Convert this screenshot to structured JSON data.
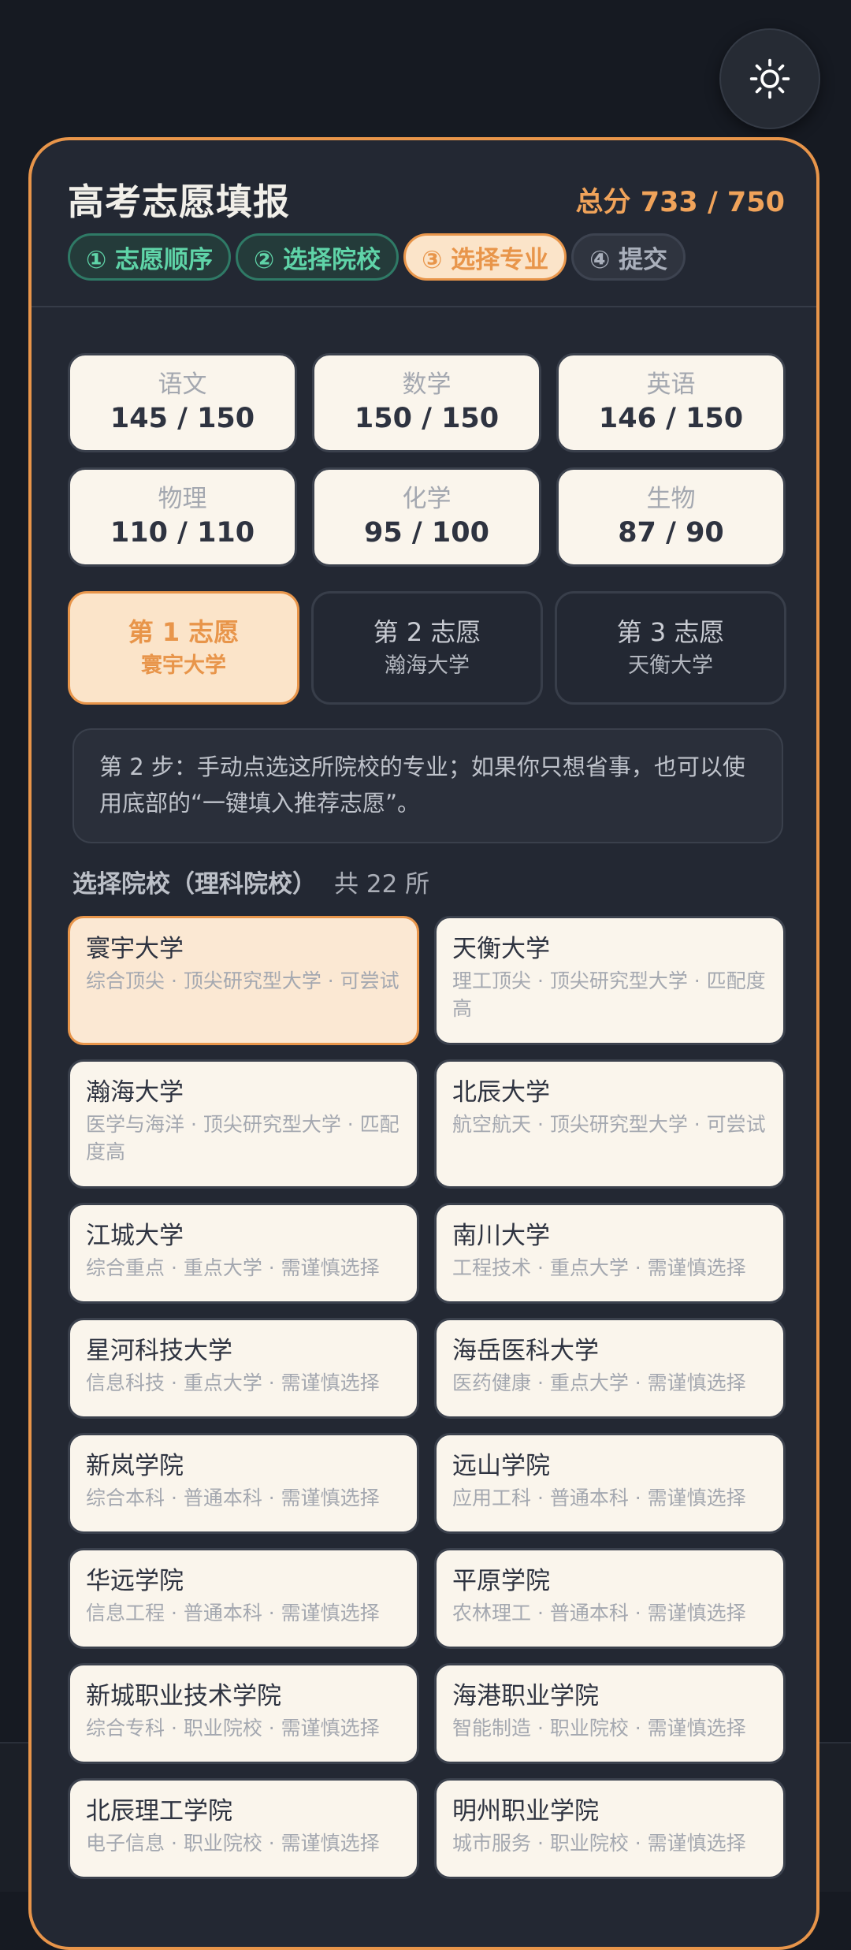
{
  "header": {
    "title": "高考志愿填报",
    "total_score": "总分 733 / 750"
  },
  "steps": [
    {
      "label": "① 志愿顺序",
      "state": "done"
    },
    {
      "label": "② 选择院校",
      "state": "done"
    },
    {
      "label": "③ 选择专业",
      "state": "active"
    },
    {
      "label": "④ 提交",
      "state": "todo"
    }
  ],
  "scores": [
    {
      "subject": "语文",
      "value": "145 / 150"
    },
    {
      "subject": "数学",
      "value": "150 / 150"
    },
    {
      "subject": "英语",
      "value": "146 / 150"
    },
    {
      "subject": "物理",
      "value": "110 / 110"
    },
    {
      "subject": "化学",
      "value": "95 / 100"
    },
    {
      "subject": "生物",
      "value": "87 / 90"
    }
  ],
  "choices": [
    {
      "title": "第 1 志愿",
      "school": "寰宇大学",
      "active": true
    },
    {
      "title": "第 2 志愿",
      "school": "瀚海大学",
      "active": false
    },
    {
      "title": "第 3 志愿",
      "school": "天衡大学",
      "active": false
    }
  ],
  "hint": "第 2 步：手动点选这所院校的专业；如果你只想省事，也可以使用底部的“一键填入推荐志愿”。",
  "schools_section": {
    "title": "选择院校（理科院校）",
    "count": "共 22 所"
  },
  "schools": [
    {
      "name": "寰宇大学",
      "meta": "综合顶尖 · 顶尖研究型大学 · 可尝试",
      "selected": true
    },
    {
      "name": "天衡大学",
      "meta": "理工顶尖 · 顶尖研究型大学 · 匹配度高"
    },
    {
      "name": "瀚海大学",
      "meta": "医学与海洋 · 顶尖研究型大学 · 匹配度高"
    },
    {
      "name": "北辰大学",
      "meta": "航空航天 · 顶尖研究型大学 · 可尝试"
    },
    {
      "name": "江城大学",
      "meta": "综合重点 · 重点大学 · 需谨慎选择"
    },
    {
      "name": "南川大学",
      "meta": "工程技术 · 重点大学 · 需谨慎选择"
    },
    {
      "name": "星河科技大学",
      "meta": "信息科技 · 重点大学 · 需谨慎选择"
    },
    {
      "name": "海岳医科大学",
      "meta": "医药健康 · 重点大学 · 需谨慎选择"
    },
    {
      "name": "新岚学院",
      "meta": "综合本科 · 普通本科 · 需谨慎选择"
    },
    {
      "name": "远山学院",
      "meta": "应用工科 · 普通本科 · 需谨慎选择"
    },
    {
      "name": "华远学院",
      "meta": "信息工程 · 普通本科 · 需谨慎选择"
    },
    {
      "name": "平原学院",
      "meta": "农林理工 · 普通本科 · 需谨慎选择"
    },
    {
      "name": "新城职业技术学院",
      "meta": "综合专科 · 职业院校 · 需谨慎选择"
    },
    {
      "name": "海港职业学院",
      "meta": "智能制造 · 职业院校 · 需谨慎选择"
    },
    {
      "name": "北辰理工学院",
      "meta": "电子信息 · 职业院校 · 需谨慎选择"
    },
    {
      "name": "明州职业学院",
      "meta": "城市服务 · 职业院校 · 需谨慎选择"
    }
  ],
  "colors": {
    "accent": "#e8954a",
    "done_step": "#5fd4a8",
    "background": "#161a22",
    "panel": "#232833",
    "card": "#faf5ec"
  },
  "icons": {
    "theme_toggle": "sun-icon"
  }
}
